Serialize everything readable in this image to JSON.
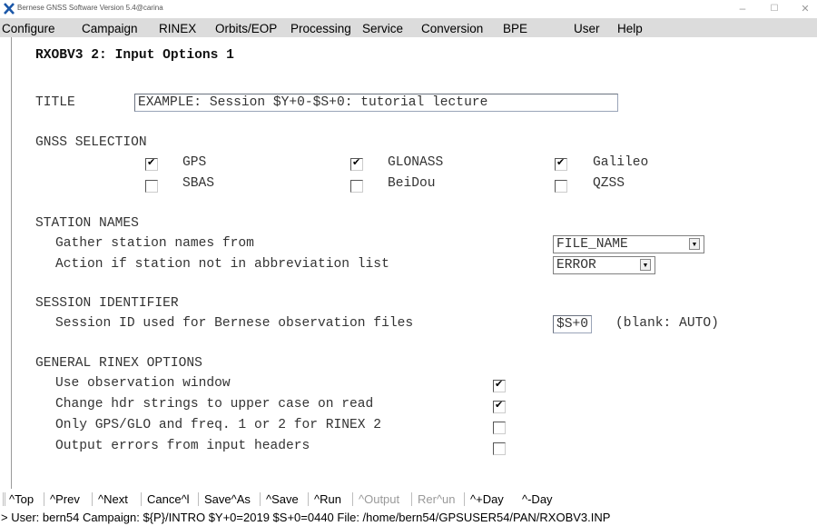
{
  "window": {
    "title": "Bernese GNSS Software Version 5.4@carina",
    "controls": [
      "–",
      "☐",
      "✕"
    ]
  },
  "menu": [
    "Configure",
    "Campaign",
    "RINEX",
    "Orbits/EOP",
    "Processing",
    "Service",
    "Conversion",
    "BPE",
    "User",
    "Help"
  ],
  "panel_title": "RXOBV3 2: Input Options 1",
  "title_field": {
    "label": "TITLE",
    "value": "EXAMPLE: Session $Y+0-$S+0: tutorial lecture"
  },
  "gnss": {
    "heading": "GNSS SELECTION",
    "options": [
      {
        "label": "GPS",
        "checked": true
      },
      {
        "label": "GLONASS",
        "checked": true
      },
      {
        "label": "Galileo",
        "checked": true
      },
      {
        "label": "SBAS",
        "checked": false
      },
      {
        "label": "BeiDou",
        "checked": false
      },
      {
        "label": "QZSS",
        "checked": false
      }
    ]
  },
  "station": {
    "heading": "STATION NAMES",
    "gather_label": "Gather station names from",
    "gather_value": "FILE_NAME",
    "action_label": "Action if station not in abbreviation list",
    "action_value": "ERROR"
  },
  "session": {
    "heading": "SESSION IDENTIFIER",
    "label": "Session ID used for Bernese observation files",
    "value": "$S+0",
    "hint": "(blank: AUTO)"
  },
  "general": {
    "heading": "GENERAL RINEX OPTIONS",
    "options": [
      {
        "label": "Use observation window",
        "checked": true
      },
      {
        "label": "Change hdr strings to upper case on read",
        "checked": true
      },
      {
        "label": "Only GPS/GLO and freq. 1 or 2 for RINEX 2",
        "checked": false
      },
      {
        "label": "Output errors from input headers",
        "checked": false
      }
    ]
  },
  "toolbar": {
    "top": "^Top",
    "prev": "^Prev",
    "next": "^Next",
    "cancel": "Cance^l",
    "saveas": "Save^As",
    "save": "^Save",
    "run": "^Run",
    "output": "^Output",
    "rerun": "Rer^un",
    "plusday": "^+Day",
    "minusday": "^-Day"
  },
  "status": "> User: bern54  Campaign: ${P}/INTRO   $Y+0=2019  $S+0=0440   File: /home/bern54/GPSUSER54/PAN/RXOBV3.INP",
  "colors": {
    "menu_bg": "#dcdcdc",
    "app_icon": "#1b57a8"
  }
}
